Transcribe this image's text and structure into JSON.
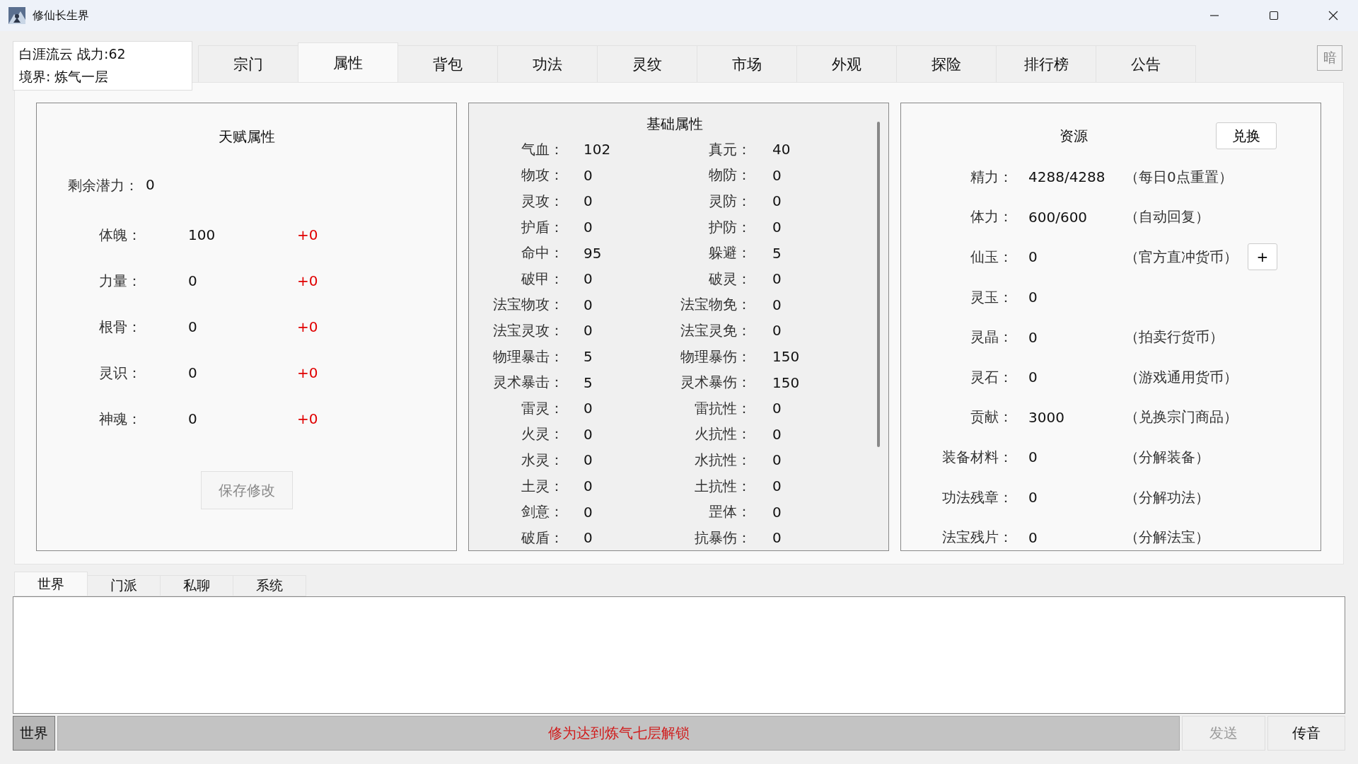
{
  "window": {
    "title": "修仙长生界"
  },
  "player": {
    "name_power": "白涯流云  战力:62",
    "realm": "境界: 炼气一层"
  },
  "tabs": [
    {
      "label": "宗门",
      "selected": false
    },
    {
      "label": "属性",
      "selected": true
    },
    {
      "label": "背包",
      "selected": false
    },
    {
      "label": "功法",
      "selected": false
    },
    {
      "label": "灵纹",
      "selected": false
    },
    {
      "label": "市场",
      "selected": false
    },
    {
      "label": "外观",
      "selected": false
    },
    {
      "label": "探险",
      "selected": false
    },
    {
      "label": "排行榜",
      "selected": false
    },
    {
      "label": "公告",
      "selected": false
    }
  ],
  "theme_button": "暗",
  "talent": {
    "title": "天赋属性",
    "remaining_label": "剩余潜力：",
    "remaining_value": "0",
    "attributes": [
      {
        "label": "体魄：",
        "value": "100",
        "bonus": "+0"
      },
      {
        "label": "力量：",
        "value": "0",
        "bonus": "+0"
      },
      {
        "label": "根骨：",
        "value": "0",
        "bonus": "+0"
      },
      {
        "label": "灵识：",
        "value": "0",
        "bonus": "+0"
      },
      {
        "label": "神魂：",
        "value": "0",
        "bonus": "+0"
      }
    ],
    "save_button": {
      "label": "保存修改",
      "disabled": true
    }
  },
  "base": {
    "title": "基础属性",
    "rows": [
      {
        "label": "气血：",
        "value": "102",
        "label_2": "真元：",
        "value_2": "40"
      },
      {
        "label": "物攻：",
        "value": "0",
        "label_2": "物防：",
        "value_2": "0"
      },
      {
        "label": "灵攻：",
        "value": "0",
        "label_2": "灵防：",
        "value_2": "0"
      },
      {
        "label": "护盾：",
        "value": "0",
        "label_2": "护防：",
        "value_2": "0"
      },
      {
        "label": "命中：",
        "value": "95",
        "label_2": "躲避：",
        "value_2": "5"
      },
      {
        "label": "破甲：",
        "value": "0",
        "label_2": "破灵：",
        "value_2": "0"
      },
      {
        "label": "法宝物攻：",
        "value": "0",
        "label_2": "法宝物免：",
        "value_2": "0"
      },
      {
        "label": "法宝灵攻：",
        "value": "0",
        "label_2": "法宝灵免：",
        "value_2": "0"
      },
      {
        "label": "物理暴击：",
        "value": "5",
        "label_2": "物理暴伤：",
        "value_2": "150"
      },
      {
        "label": "灵术暴击：",
        "value": "5",
        "label_2": "灵术暴伤：",
        "value_2": "150"
      },
      {
        "label": "雷灵：",
        "value": "0",
        "label_2": "雷抗性：",
        "value_2": "0"
      },
      {
        "label": "火灵：",
        "value": "0",
        "label_2": "火抗性：",
        "value_2": "0"
      },
      {
        "label": "水灵：",
        "value": "0",
        "label_2": "水抗性：",
        "value_2": "0"
      },
      {
        "label": "土灵：",
        "value": "0",
        "label_2": "土抗性：",
        "value_2": "0"
      },
      {
        "label": "剑意：",
        "value": "0",
        "label_2": "罡体：",
        "value_2": "0"
      },
      {
        "label": "破盾：",
        "value": "0",
        "label_2": "抗暴伤：",
        "value_2": "0"
      }
    ]
  },
  "resources": {
    "title": "资源",
    "exchange_button": "兑换",
    "rows": [
      {
        "label": "精力：",
        "value": "4288/4288",
        "note": "（每日0点重置）"
      },
      {
        "label": "体力：",
        "value": "600/600",
        "note": "（自动回复）"
      },
      {
        "label": "仙玉：",
        "value": "0",
        "note": "（官方直冲货币）",
        "button": "+"
      },
      {
        "label": "灵玉：",
        "value": "0"
      },
      {
        "label": "灵晶：",
        "value": "0",
        "note": "（拍卖行货币）"
      },
      {
        "label": "灵石：",
        "value": "0",
        "note": "（游戏通用货币）"
      },
      {
        "label": "贡献：",
        "value": "3000",
        "note": "（兑换宗门商品）"
      },
      {
        "label": "装备材料：",
        "value": "0",
        "note": "（分解装备）"
      },
      {
        "label": "功法残章：",
        "value": "0",
        "note": "（分解功法）"
      },
      {
        "label": "法宝残片：",
        "value": "0",
        "note": "（分解法宝）"
      }
    ]
  },
  "chat_tabs": [
    {
      "label": "世界",
      "selected": true
    },
    {
      "label": "门派",
      "selected": false
    },
    {
      "label": "私聊",
      "selected": false
    },
    {
      "label": "系统",
      "selected": false
    }
  ],
  "chat_input": {
    "channel": "世界",
    "message": "修为达到炼气七层解锁",
    "disabled": true
  },
  "send_button": {
    "label": "发送",
    "disabled": true
  },
  "voice_button": {
    "label": "传音",
    "disabled": false
  }
}
